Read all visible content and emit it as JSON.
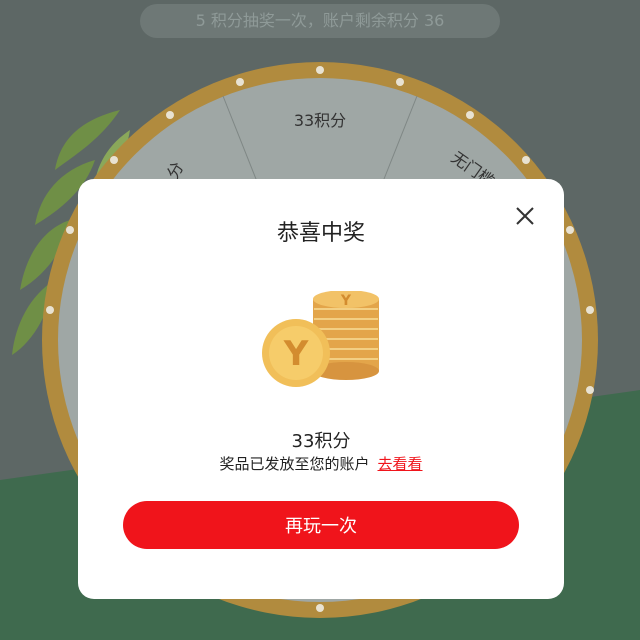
{
  "header": {
    "lottery_info": "5 积分抽奖一次，账户剩余积分 36"
  },
  "wheel": {
    "segments": [
      "33积分",
      "无门槛",
      "分"
    ]
  },
  "modal": {
    "title": "恭喜中奖",
    "prize_amount": "33积分",
    "message": "奖品已发放至您的账户",
    "link_text": "去看看",
    "button_label": "再玩一次",
    "close_icon": "close-icon",
    "coin_icon": "coins-icon",
    "accent_color": "#f0141b"
  }
}
